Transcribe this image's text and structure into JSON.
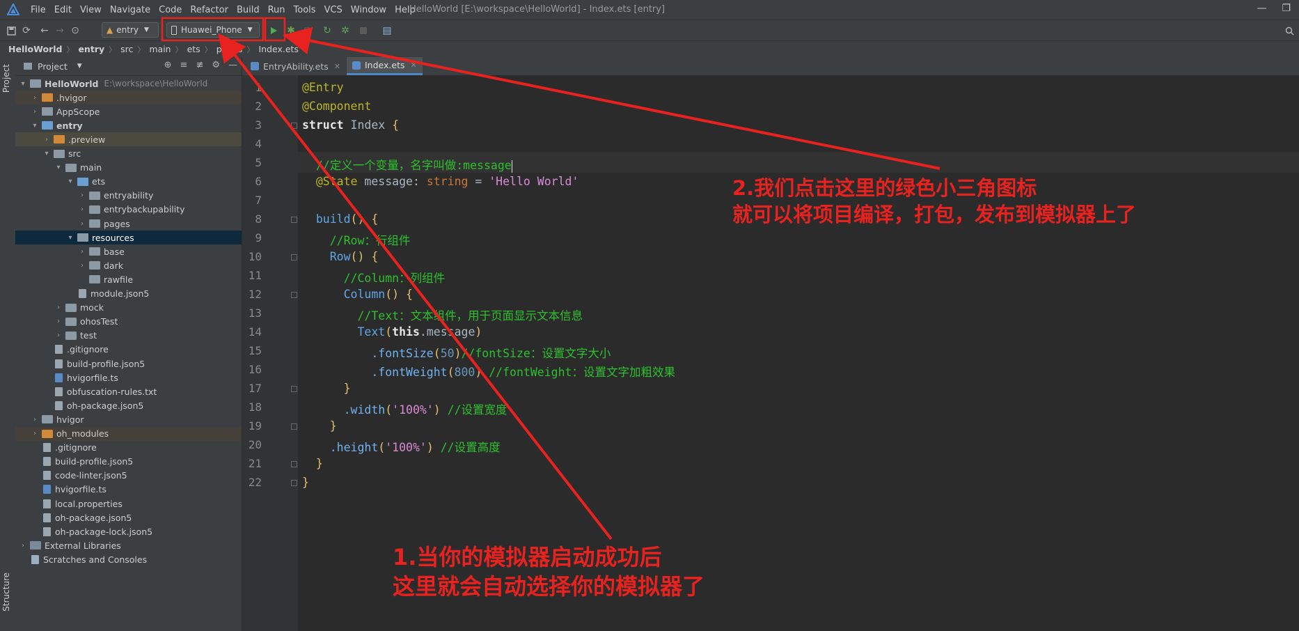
{
  "app": {
    "menus": [
      "File",
      "Edit",
      "View",
      "Navigate",
      "Code",
      "Refactor",
      "Build",
      "Run",
      "Tools",
      "VCS",
      "Window",
      "Help"
    ],
    "window_title": "HelloWorld [E:\\workspace\\HelloWorld] - Index.ets [entry]"
  },
  "toolbar": {
    "module_combo": "entry",
    "device_combo": "Huawei_Phone"
  },
  "breadcrumb": [
    "HelloWorld",
    "entry",
    "src",
    "main",
    "ets",
    "pages",
    "Index.ets"
  ],
  "sidebar": {
    "project_tab": "Project",
    "structure_tab": "Structure",
    "header": "Project",
    "tree": [
      {
        "label": "HelloWorld",
        "path": "E:\\workspace\\HelloWorld"
      },
      {
        "label": ".hvigor"
      },
      {
        "label": "AppScope"
      },
      {
        "label": "entry"
      },
      {
        "label": ".preview"
      },
      {
        "label": "src"
      },
      {
        "label": "main"
      },
      {
        "label": "ets"
      },
      {
        "label": "entryability"
      },
      {
        "label": "entrybackupability"
      },
      {
        "label": "pages"
      },
      {
        "label": "resources"
      },
      {
        "label": "base"
      },
      {
        "label": "dark"
      },
      {
        "label": "rawfile"
      },
      {
        "label": "module.json5"
      },
      {
        "label": "mock"
      },
      {
        "label": "ohosTest"
      },
      {
        "label": "test"
      },
      {
        "label": ".gitignore"
      },
      {
        "label": "build-profile.json5"
      },
      {
        "label": "hvigorfile.ts"
      },
      {
        "label": "obfuscation-rules.txt"
      },
      {
        "label": "oh-package.json5"
      },
      {
        "label": "hvigor"
      },
      {
        "label": "oh_modules"
      },
      {
        "label": ".gitignore"
      },
      {
        "label": "build-profile.json5"
      },
      {
        "label": "code-linter.json5"
      },
      {
        "label": "hvigorfile.ts"
      },
      {
        "label": "local.properties"
      },
      {
        "label": "oh-package.json5"
      },
      {
        "label": "oh-package-lock.json5"
      },
      {
        "label": "External Libraries"
      },
      {
        "label": "Scratches and Consoles"
      }
    ]
  },
  "tabs": [
    {
      "label": "EntryAbility.ets"
    },
    {
      "label": "Index.ets"
    }
  ],
  "code": {
    "line_numbers": [
      "1",
      "2",
      "3",
      "4",
      "5",
      "6",
      "7",
      "8",
      "9",
      "10",
      "11",
      "12",
      "13",
      "14",
      "15",
      "16",
      "17",
      "18",
      "19",
      "20",
      "21",
      "22"
    ],
    "lines": [
      [
        {
          "t": "@Entry",
          "c": "k-ann"
        }
      ],
      [
        {
          "t": "@Component",
          "c": "k-ann"
        }
      ],
      [
        {
          "t": "struct ",
          "c": "k-struct"
        },
        {
          "t": "Index ",
          "c": "k-name"
        },
        {
          "t": "{",
          "c": "k-punc"
        }
      ],
      [],
      [
        {
          "t": "  //定义一个变量，名字叫做:message",
          "c": "k-com"
        }
      ],
      [
        {
          "t": "  @State ",
          "c": "k-ann"
        },
        {
          "t": "message",
          "c": "k-name"
        },
        {
          "t": ": ",
          "c": "k-name"
        },
        {
          "t": "string",
          "c": "k-type"
        },
        {
          "t": " = ",
          "c": "k-name"
        },
        {
          "t": "'Hello World'",
          "c": "k-str"
        }
      ],
      [],
      [
        {
          "t": "  build",
          "c": "k-fn"
        },
        {
          "t": "() {",
          "c": "k-punc"
        }
      ],
      [
        {
          "t": "    //Row：行组件",
          "c": "k-com"
        }
      ],
      [
        {
          "t": "    Row",
          "c": "k-fn"
        },
        {
          "t": "() {",
          "c": "k-punc"
        }
      ],
      [
        {
          "t": "      //Column：列组件",
          "c": "k-com"
        }
      ],
      [
        {
          "t": "      Column",
          "c": "k-fn"
        },
        {
          "t": "() {",
          "c": "k-punc"
        }
      ],
      [
        {
          "t": "        //Text：文本组件，用于页面显示文本信息",
          "c": "k-com"
        }
      ],
      [
        {
          "t": "        Text",
          "c": "k-fn"
        },
        {
          "t": "(",
          "c": "k-punc"
        },
        {
          "t": "this",
          "c": "k-this"
        },
        {
          "t": ".message",
          "c": "k-name"
        },
        {
          "t": ")",
          "c": "k-punc"
        }
      ],
      [
        {
          "t": "          .fontSize",
          "c": "k-meth"
        },
        {
          "t": "(",
          "c": "k-punc"
        },
        {
          "t": "50",
          "c": "k-num"
        },
        {
          "t": ")",
          "c": "k-punc"
        },
        {
          "t": "//fontSize：设置文字大小",
          "c": "k-com"
        }
      ],
      [
        {
          "t": "          .fontWeight",
          "c": "k-meth"
        },
        {
          "t": "(",
          "c": "k-punc"
        },
        {
          "t": "800",
          "c": "k-num"
        },
        {
          "t": ") ",
          "c": "k-punc"
        },
        {
          "t": "//fontWeight：设置文字加粗效果",
          "c": "k-com"
        }
      ],
      [
        {
          "t": "      }",
          "c": "k-punc"
        }
      ],
      [
        {
          "t": "      .width",
          "c": "k-meth"
        },
        {
          "t": "(",
          "c": "k-punc"
        },
        {
          "t": "'100%'",
          "c": "k-str"
        },
        {
          "t": ") ",
          "c": "k-punc"
        },
        {
          "t": "//设置宽度",
          "c": "k-com"
        }
      ],
      [
        {
          "t": "    }",
          "c": "k-punc"
        }
      ],
      [
        {
          "t": "    .height",
          "c": "k-meth"
        },
        {
          "t": "(",
          "c": "k-punc"
        },
        {
          "t": "'100%'",
          "c": "k-str"
        },
        {
          "t": ") ",
          "c": "k-punc"
        },
        {
          "t": "//设置高度",
          "c": "k-com"
        }
      ],
      [
        {
          "t": "  }",
          "c": "k-punc"
        }
      ],
      [
        {
          "t": "}",
          "c": "k-punc"
        }
      ]
    ]
  },
  "annotations": {
    "note2_line1": "2.我们点击这里的绿色小三角图标",
    "note2_line2": "就可以将项目编译，打包，发布到模拟器上了",
    "note1_line1": "1.当你的模拟器启动成功后",
    "note1_line2": "这里就会自动选择你的模拟器了"
  },
  "colors": {
    "annotation_red": "#e8221f",
    "run_green": "#4caf50",
    "ide_bg": "#2b2b2b",
    "panel_bg": "#3c3f41"
  }
}
